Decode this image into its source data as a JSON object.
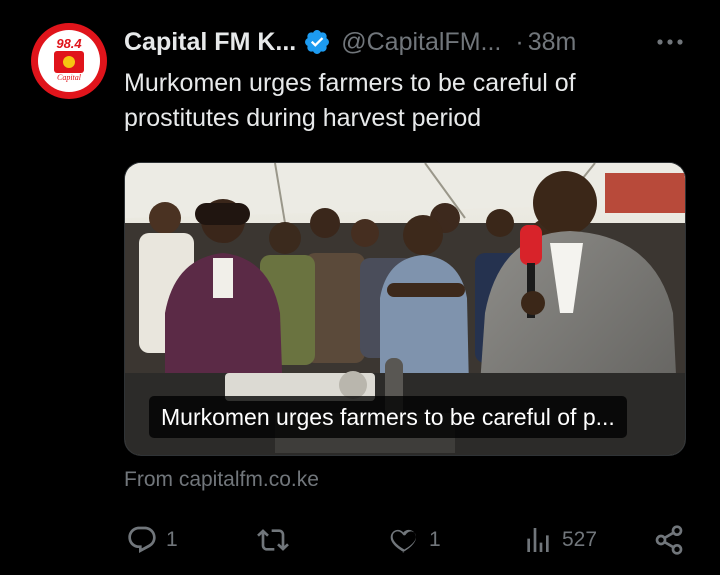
{
  "author": {
    "display_name": "Capital FM K...",
    "handle": "@CapitalFM...",
    "separator": "·",
    "time": "38m",
    "verified": true,
    "avatar": {
      "frequency": "98.4",
      "wordmark": "Capital"
    }
  },
  "tweet": {
    "text": "Murkomen urges farmers to be careful of prostitutes during harvest period"
  },
  "link_card": {
    "title": "Murkomen urges farmers to be careful of p...",
    "source": "From capitalfm.co.ke"
  },
  "actions": {
    "replies": "1",
    "retweets": "",
    "likes": "1",
    "views": "527"
  },
  "icons": {
    "more": "more-icon",
    "verified": "verified-badge-icon",
    "reply": "reply-icon",
    "retweet": "retweet-icon",
    "like": "heart-icon",
    "views": "views-icon",
    "share": "share-icon"
  },
  "colors": {
    "background": "#000000",
    "text_primary": "#e7e9ea",
    "text_secondary": "#71767b",
    "verified_blue": "#1d9bf0",
    "brand_red": "#e0141b"
  }
}
